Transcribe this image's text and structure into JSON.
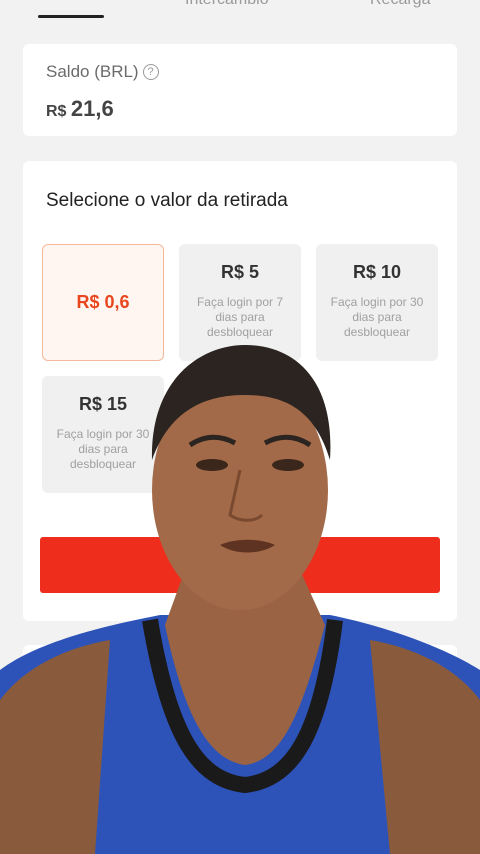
{
  "tabs": [
    {
      "label": ""
    },
    {
      "label": "Intercâmbio"
    },
    {
      "label": "Recarga"
    }
  ],
  "balance": {
    "label": "Saldo (BRL)",
    "currency": "R$",
    "amount": "21,6"
  },
  "withdraw": {
    "title": "Selecione o valor da retirada",
    "options": [
      {
        "amount": "R$ 0,6",
        "note": "",
        "selected": true
      },
      {
        "amount": "R$ 5",
        "note": "Faça login por 7 dias para desbloquear",
        "selected": false
      },
      {
        "amount": "R$ 10",
        "note": "Faça login por 30 dias para desbloquear",
        "selected": false
      },
      {
        "amount": "R$ 15",
        "note": "Faça login por 30 dias para desbloquear",
        "selected": false
      }
    ],
    "button_label": ""
  },
  "colors": {
    "accent": "#ee2d1d",
    "selected_text": "#e8461e",
    "overlay_shirt": "#2e53b8"
  },
  "icons": {
    "help": "question-circle-icon"
  }
}
